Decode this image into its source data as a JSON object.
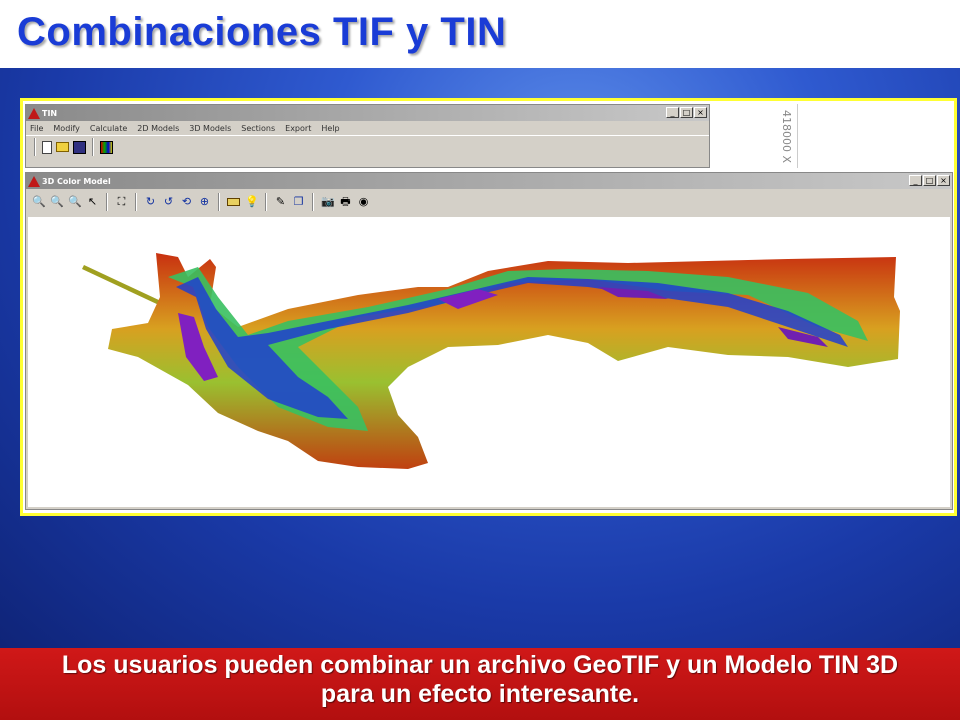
{
  "slide": {
    "title": "Combinaciones TIF y TIN",
    "caption": "Los usuarios pueden combinar un archivo GeoTIF y un Modelo TIN 3D para un efecto interesante."
  },
  "tin_window": {
    "title": "TIN",
    "menu": [
      "File",
      "Modify",
      "Calculate",
      "2D Models",
      "3D Models",
      "Sections",
      "Export",
      "Help"
    ],
    "controls": [
      "_",
      "□",
      "×"
    ]
  },
  "coord_panel": {
    "label": "418000 X"
  },
  "model_window": {
    "title": "3D Color Model",
    "controls": [
      "_",
      "□",
      "×"
    ],
    "toolbar_icons": [
      "zoom-in-icon",
      "zoom-out-icon",
      "zoom-window-icon",
      "pointer-icon",
      "fit-extent-icon",
      "rotate-x-icon",
      "rotate-y-icon",
      "rotate-z-icon",
      "pan-icon",
      "light-icon",
      "bulb-icon",
      "paint-icon",
      "layers-icon",
      "camera-icon",
      "print-icon",
      "globe-icon"
    ]
  },
  "colors": {
    "title": "#1a3cd6",
    "frame": "#ffff33",
    "caption_bg": "#c81414",
    "slide_bg": "#2f5ad0"
  }
}
